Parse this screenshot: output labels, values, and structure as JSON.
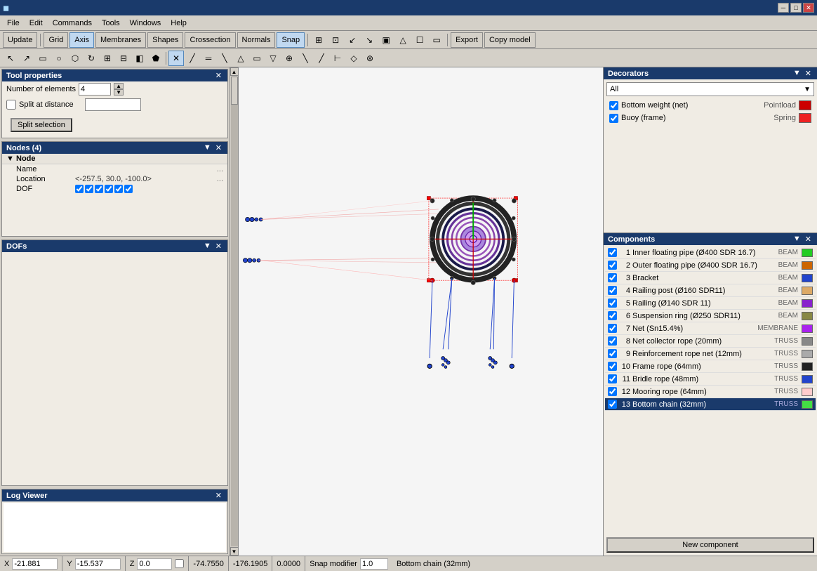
{
  "titlebar": {
    "icon": "◼",
    "title": "",
    "minimize": "─",
    "maximize": "□",
    "close": "✕"
  },
  "menubar": {
    "items": [
      "File",
      "Edit",
      "Commands",
      "Tools",
      "Windows",
      "Help"
    ]
  },
  "toolbar1": {
    "buttons": [
      "Update",
      "Grid",
      "Axis",
      "Membranes",
      "Shapes",
      "Crossection",
      "Normals",
      "Snap",
      "Export",
      "Copy model"
    ]
  },
  "toolbar2": {
    "tools": [
      "↖",
      "↗",
      "▭",
      "○",
      "⬡",
      "↻",
      "⊞",
      "⊟",
      "◧",
      "⬟",
      "⊕",
      "✕",
      "╱",
      "═",
      "╱",
      "△",
      "▭",
      "▽",
      "⊕",
      "╲",
      "╱",
      "⊢",
      "◇",
      "⊛"
    ]
  },
  "tool_properties": {
    "title": "Tool properties",
    "number_of_elements_label": "Number of elements",
    "number_of_elements_value": "4",
    "split_at_distance_label": "Split at distance",
    "split_at_distance_checked": false,
    "split_at_distance_value": "",
    "split_selection_label": "Split selection"
  },
  "nodes_panel": {
    "title": "Nodes (4)",
    "node_label": "Node",
    "name_label": "Name",
    "location_label": "Location",
    "location_value": "<-257.5, 30.0, -100.0>",
    "dof_label": "DOF",
    "dof_values": [
      "☑",
      "☑",
      "☑",
      "☑",
      "☑",
      "☑"
    ]
  },
  "dofs_panel": {
    "title": "DOFs"
  },
  "log_panel": {
    "title": "Log Viewer"
  },
  "decorators_panel": {
    "title": "Decorators",
    "filter": "All",
    "items": [
      {
        "checked": true,
        "name": "Bottom weight (net)",
        "type": "Pointload",
        "color": "#cc0000"
      },
      {
        "checked": true,
        "name": "Buoy (frame)",
        "type": "Spring",
        "color": "#ee2222"
      }
    ]
  },
  "components_panel": {
    "title": "Components",
    "items": [
      {
        "num": 1,
        "name": "Inner floating pipe (Ø400 SDR 16.7)",
        "type": "BEAM",
        "color": "#22cc22",
        "checked": true
      },
      {
        "num": 2,
        "name": "Outer floating pipe (Ø400 SDR 16.7)",
        "type": "BEAM",
        "color": "#cc6600",
        "checked": true
      },
      {
        "num": 3,
        "name": "Bracket",
        "type": "BEAM",
        "color": "#2244cc",
        "checked": true
      },
      {
        "num": 4,
        "name": "Railing post (Ø160 SDR11)",
        "type": "BEAM",
        "color": "#ddaa66",
        "checked": true
      },
      {
        "num": 5,
        "name": "Railing (Ø140 SDR 11)",
        "type": "BEAM",
        "color": "#8822cc",
        "checked": true
      },
      {
        "num": 6,
        "name": "Suspension ring (Ø250 SDR11)",
        "type": "BEAM",
        "color": "#888844",
        "checked": true
      },
      {
        "num": 7,
        "name": "Net (Sn15.4%)",
        "type": "MEMBRANE",
        "color": "#aa22ee",
        "checked": true
      },
      {
        "num": 8,
        "name": "Net collector rope (20mm)",
        "type": "TRUSS",
        "color": "#888888",
        "checked": true
      },
      {
        "num": 9,
        "name": "Reinforcement rope net (12mm)",
        "type": "TRUSS",
        "color": "#aaaaaa",
        "checked": true
      },
      {
        "num": 10,
        "name": "Frame rope (64mm)",
        "type": "TRUSS",
        "color": "#222222",
        "checked": true
      },
      {
        "num": 11,
        "name": "Bridle rope (48mm)",
        "type": "TRUSS",
        "color": "#2244cc",
        "checked": true
      },
      {
        "num": 12,
        "name": "Mooring rope (64mm)",
        "type": "TRUSS",
        "color": "#ffcccc",
        "checked": true
      },
      {
        "num": 13,
        "name": "Bottom chain (32mm)",
        "type": "TRUSS",
        "color": "#44dd44",
        "checked": true,
        "selected": true
      }
    ],
    "new_component_label": "New component"
  },
  "statusbar": {
    "x_label": "X",
    "x_value": "-21.881",
    "y_label": "Y",
    "y_value": "-15.537",
    "z_label": "Z",
    "z_value": "0.0",
    "coord1": "-74.7550",
    "coord2": "-176.1905",
    "coord3": "0.0000",
    "snap_modifier_label": "Snap modifier",
    "snap_modifier_value": "1.0",
    "status_info": "Bottom chain (32mm)"
  }
}
